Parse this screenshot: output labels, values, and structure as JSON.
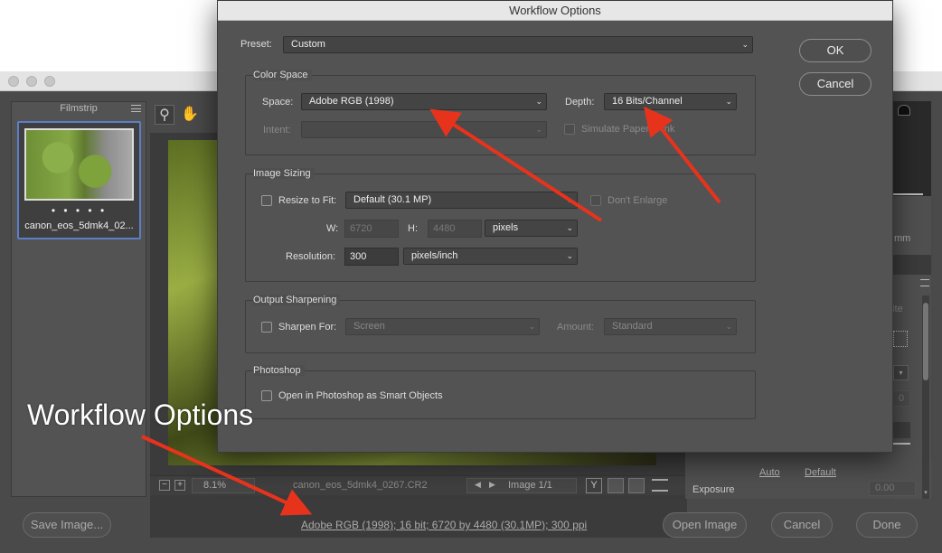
{
  "main_window": {
    "filmstrip": {
      "title": "Filmstrip",
      "thumbnail_name": "canon_eos_5dmk4_02...",
      "stars": "• • • • •"
    },
    "preview": {
      "zoom": "8.1%",
      "filename": "canon_eos_5dmk4_0267.CR2",
      "image_counter": "Image 1/1"
    },
    "right_panel": {
      "unit_fragment": "mm",
      "fragment_ite": "ite",
      "auto_link": "Auto",
      "default_link": "Default",
      "exposure_label": "Exposure",
      "exposure_value": "0.00",
      "zero_value": "0"
    },
    "bottom": {
      "save_image": "Save Image...",
      "workflow_link": "Adobe RGB (1998); 16 bit; 6720 by 4480 (30.1MP); 300 ppi",
      "open_image": "Open Image",
      "cancel": "Cancel",
      "done": "Done"
    }
  },
  "dialog": {
    "title": "Workflow Options",
    "preset_label": "Preset:",
    "preset_value": "Custom",
    "ok": "OK",
    "cancel": "Cancel",
    "color_space": {
      "title": "Color Space",
      "space_label": "Space:",
      "space_value": "Adobe RGB (1998)",
      "depth_label": "Depth:",
      "depth_value": "16 Bits/Channel",
      "intent_label": "Intent:",
      "intent_value": "",
      "simulate_label": "Simulate Paper & Ink"
    },
    "image_sizing": {
      "title": "Image Sizing",
      "resize_label": "Resize to Fit:",
      "resize_value": "Default  (30.1 MP)",
      "dont_enlarge": "Don't Enlarge",
      "w_label": "W:",
      "w_value": "6720",
      "h_label": "H:",
      "h_value": "4480",
      "unit_value": "pixels",
      "resolution_label": "Resolution:",
      "resolution_value": "300",
      "resolution_unit": "pixels/inch"
    },
    "output_sharpening": {
      "title": "Output Sharpening",
      "sharpen_label": "Sharpen For:",
      "sharpen_value": "Screen",
      "amount_label": "Amount:",
      "amount_value": "Standard"
    },
    "photoshop": {
      "title": "Photoshop",
      "smart_objects_label": "Open in Photoshop as Smart Objects"
    }
  },
  "annotation": {
    "text": "Workflow Options",
    "arrow_color": "#e8331c"
  }
}
